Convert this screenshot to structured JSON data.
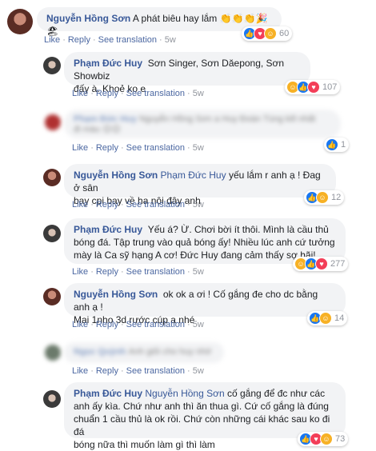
{
  "comments": [
    {
      "author": "Nguyễn Hồng Sơn",
      "text": "A phát biêu hay lắm",
      "emojis": "👏👏👏🎉🏖",
      "actions": {
        "like": "Like",
        "reply": "Reply",
        "translate": "See translation",
        "time": "5w"
      },
      "reaction_count": "60"
    },
    {
      "author": "Phạm Đức Huy",
      "text_line1": "Sơn Singer, Sơn Dăepong, Sơn Showbiz",
      "text_line2": "đấy à. Khoẻ ko e",
      "actions": {
        "like": "Like",
        "reply": "Reply",
        "translate": "See translation",
        "time": "5w"
      },
      "reaction_count": "107"
    },
    {
      "author": "Phạm Đức Huy",
      "text_line1": "Nguyễn Hồng Sơn a Huy Đoàn Tùng kill nhất",
      "text_line2": "đi màu 😊😊",
      "actions": {
        "like": "Like",
        "reply": "Reply",
        "translate": "See translation",
        "time": "5w"
      },
      "reaction_count": "1"
    },
    {
      "author": "Nguyễn Hồng Sơn",
      "mention": "Phạm Đức Huy",
      "text_line1": " yếu lắm r anh ạ ! Đag ở sân",
      "text_line2": "bay cpi bay về ha nội đây anh",
      "actions": {
        "like": "Like",
        "reply": "Reply",
        "translate": "See translation",
        "time": "5w"
      },
      "reaction_count": "12"
    },
    {
      "author": "Phạm Đức Huy",
      "text_line1": "Yếu á? Ừ. Chơi bời ít thôi. Mình là cầu thủ",
      "text_line2": "bóng đá. Tập trung vào quả bóng ấy! Nhiều lúc anh cứ tưởng",
      "text_line3": "mày là Ca sỹ hạng A cơ! Đức Huy đang cảm thấy sợ hãi!",
      "actions": {
        "like": "Like",
        "reply": "Reply",
        "translate": "See translation",
        "time": "5w"
      },
      "reaction_count": "277"
    },
    {
      "author": "Nguyễn Hồng Sơn",
      "text_line1": "ok ok a ơi ! Cố gắng đe cho dc bằng anh ạ !",
      "text_line2": "Mai 1nho 3d rước cúp a nhé",
      "actions": {
        "like": "Like",
        "reply": "Reply",
        "translate": "See translation",
        "time": "5w"
      },
      "reaction_count": "14"
    },
    {
      "author": "Ngọc Quỳnh",
      "text": "Anh giỏi cho huy nhớ",
      "actions": {
        "like": "Like",
        "reply": "Reply",
        "translate": "See translation",
        "time": "5w"
      }
    },
    {
      "author": "Phạm Đức Huy",
      "mention": "Nguyễn Hồng Sơn",
      "text_line1": " cố gắng để đc như các",
      "text_line2": "anh ấy kìa. Chứ như anh thì ăn thua gì. Cứ cố gắng là đúng",
      "text_line3": "chuẩn 1 cầu thủ là ok rồi. Chứ còn những cái khác sau ko đi đá",
      "text_line4": "bóng nữa thì muốn làm gì thì làm",
      "actions": {
        "like": "Like",
        "reply": "Reply",
        "translate": "See translation",
        "time": "5w"
      },
      "reaction_count": "73"
    }
  ],
  "colors": {
    "author": "#385898",
    "bubble": "#f2f3f5",
    "action_link": "#4b67a1",
    "muted": "#90949c",
    "like": "#1877f2",
    "love": "#f33e58",
    "haha": "#f7b125"
  },
  "icons": [
    "like-icon",
    "love-icon",
    "haha-icon",
    "sad-icon"
  ]
}
